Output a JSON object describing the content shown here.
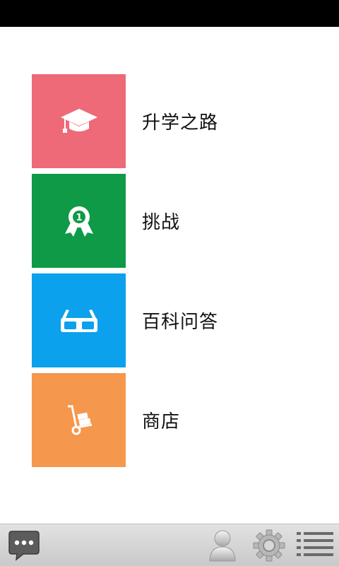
{
  "menu": {
    "items": [
      {
        "label": "升学之路",
        "color": "#ee6a78",
        "icon": "graduation-cap-icon"
      },
      {
        "label": "挑战",
        "color": "#0e9a46",
        "icon": "award-ribbon-icon"
      },
      {
        "label": "百科问答",
        "color": "#0ba1ec",
        "icon": "3d-glasses-icon"
      },
      {
        "label": "商店",
        "color": "#f5974d",
        "icon": "hand-truck-icon"
      }
    ]
  },
  "award_number": "1",
  "bottom_bar": {
    "icons": [
      "chat-icon",
      "profile-icon",
      "settings-gear-icon",
      "list-menu-icon"
    ]
  }
}
